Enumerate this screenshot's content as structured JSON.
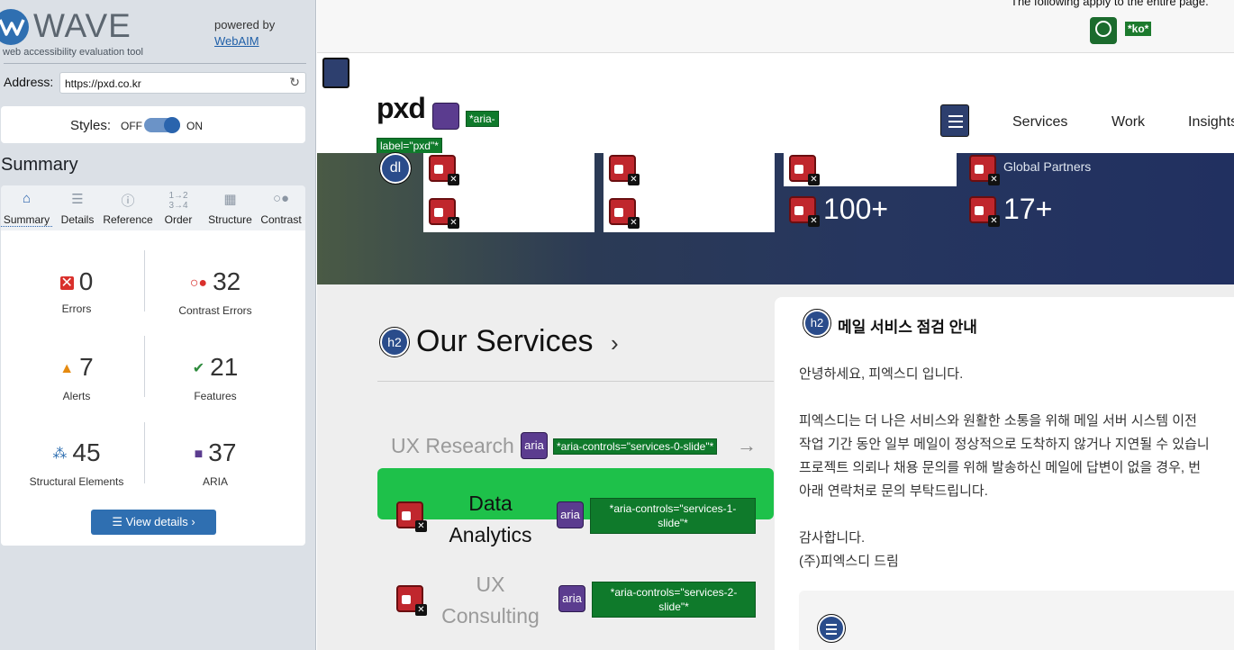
{
  "wave": {
    "logo_text": "WAVE",
    "logo_subtitle": "web accessibility evaluation tool",
    "powered_by": "powered by",
    "webaim_link": "WebAIM",
    "address_label": "Address:",
    "address_value": "https://pxd.co.kr",
    "styles_label": "Styles:",
    "styles_off": "OFF",
    "styles_on": "ON",
    "summary_heading": "Summary",
    "tabs": [
      {
        "label": "Summary",
        "icon": "home-icon"
      },
      {
        "label": "Details",
        "icon": "list-icon"
      },
      {
        "label": "Reference",
        "icon": "info-icon"
      },
      {
        "label": "Order",
        "icon": "order-icon"
      },
      {
        "label": "Structure",
        "icon": "structure-icon"
      },
      {
        "label": "Contrast",
        "icon": "contrast-icon"
      }
    ],
    "stats": {
      "errors": {
        "value": "0",
        "label": "Errors"
      },
      "contrast_errors": {
        "value": "32",
        "label": "Contrast Errors"
      },
      "alerts": {
        "value": "7",
        "label": "Alerts"
      },
      "features": {
        "value": "21",
        "label": "Features"
      },
      "structural": {
        "value": "45",
        "label": "Structural Elements"
      },
      "aria": {
        "value": "37",
        "label": "ARIA"
      }
    },
    "view_details": "View details ›"
  },
  "page": {
    "apply_text": "The following apply to the entire page.",
    "lang_tag": "*ko*",
    "brand": "pxd",
    "aria_label_tag": "*aria-label=\"pxd\"*",
    "aria_label_part1": "*aria-",
    "aria_label_part2": "label=\"pxd\"*",
    "nav": [
      "Services",
      "Work",
      "Insights"
    ],
    "hero_numbers": [
      "100+",
      "17+"
    ],
    "global_partners": "Global Partners",
    "dl_icon": "dl",
    "h2_icon": "h2",
    "services_title": "Our Services",
    "services_chevron": "›",
    "ux_research": "UX Research",
    "aria_icon_label": "aria",
    "aria_controls_0": "*aria-controls=\"services-0-slide\"*",
    "aria_controls_1a": "*aria-controls=\"services-1-",
    "aria_controls_1b": "slide\"*",
    "aria_controls_2a": "*aria-controls=\"services-2-",
    "aria_controls_2b": "slide\"*",
    "data_analytics_1": "Data",
    "data_analytics_2": "Analytics",
    "ux_consulting_1": "UX",
    "ux_consulting_2": "Consulting",
    "arrow": "→"
  },
  "modal": {
    "title": "메일 서비스 점검 안내",
    "greeting": "안녕하세요, 피엑스디 입니다.",
    "line1": "피엑스디는 더 나은 서비스와 원활한 소통을 위해 메일 서버 시스템 이전",
    "line2": "작업 기간 동안 일부 메일이 정상적으로 도착하지 않거나 지연될 수 있습니",
    "line3": "프로젝트 의뢰나 채용 문의를 위해 발송하신 메일에 답변이 없을 경우, 번",
    "line4": "아래 연락처로 문의 부탁드립니다.",
    "thanks": "감사합니다.",
    "signature": "(주)피엑스디 드림"
  },
  "colors": {
    "wave_blue": "#2f6fb1",
    "error_red": "#d9302c",
    "aria_purple": "#5b3c8f",
    "feature_green": "#1c7a2d",
    "service_card_green": "#1ec14a"
  }
}
